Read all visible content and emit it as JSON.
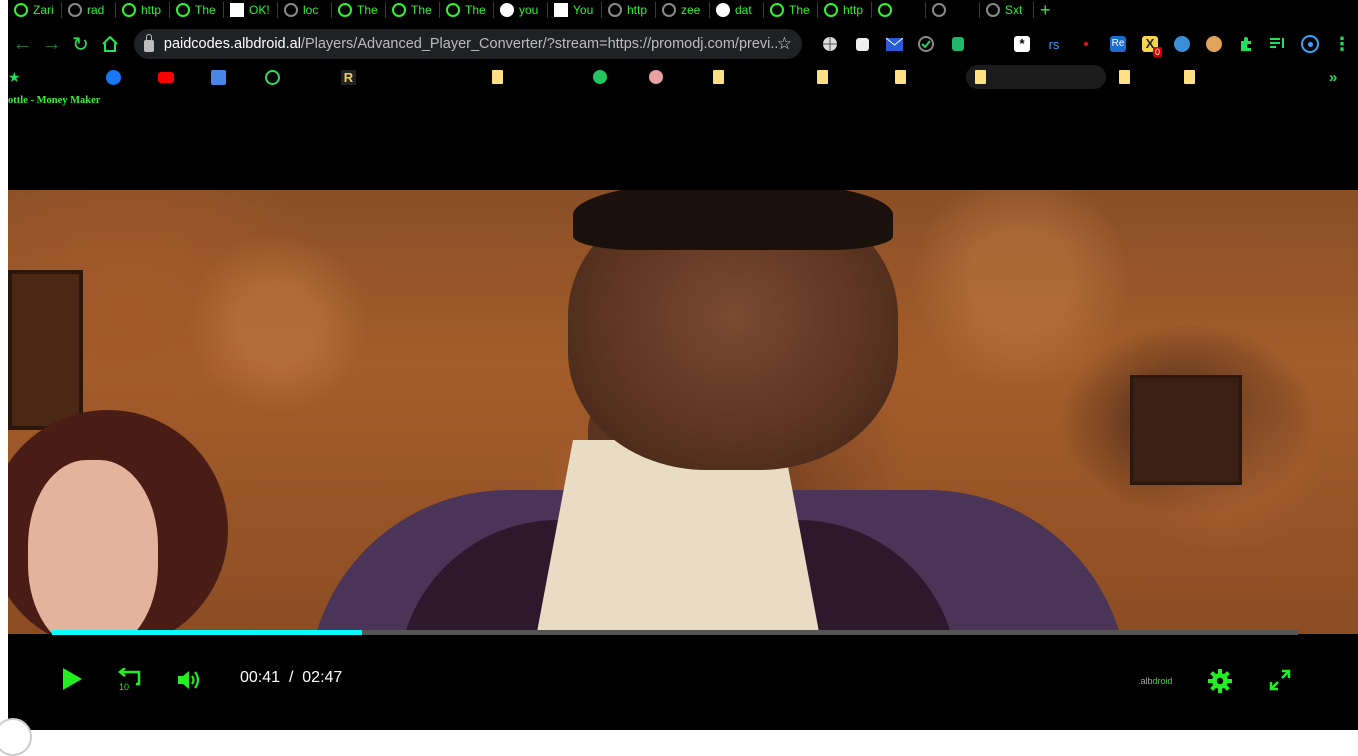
{
  "tabs": [
    {
      "label": "Zari",
      "icon": "player-icon"
    },
    {
      "label": "rad",
      "icon": "globe-gray-icon"
    },
    {
      "label": "http",
      "icon": "player-icon"
    },
    {
      "label": "The",
      "icon": "player-icon"
    },
    {
      "label": "OK!",
      "icon": "tosel-icon"
    },
    {
      "label": "loc",
      "icon": "globe-gray-icon"
    },
    {
      "label": "The",
      "icon": "player-icon"
    },
    {
      "label": "The",
      "icon": "player-icon"
    },
    {
      "label": "The",
      "icon": "player-icon"
    },
    {
      "label": "you",
      "icon": "google-icon"
    },
    {
      "label": "You",
      "icon": "blank-icon"
    },
    {
      "label": "http",
      "icon": "globe-gray-icon"
    },
    {
      "label": "zee",
      "icon": "loading-icon"
    },
    {
      "label": "dat",
      "icon": "google-icon"
    },
    {
      "label": "The",
      "icon": "player-icon"
    },
    {
      "label": "http",
      "icon": "player-icon"
    },
    {
      "label": "",
      "icon": "player-icon"
    },
    {
      "label": "",
      "icon": "mute-icon"
    },
    {
      "label": "Sxt",
      "icon": "loading-icon"
    }
  ],
  "toolbar": {
    "url_domain": "paidcodes.albdroid.al",
    "url_path": "/Players/Advanced_Player_Converter/?stream=https://promodj.com/previ...",
    "extensions_badge": "0"
  },
  "page": {
    "title": "ottle - Money Maker"
  },
  "player": {
    "current_time": "00:41",
    "separator": "/",
    "duration": "02:47",
    "progress_fraction": 0.249,
    "brand_prefix": ".alb",
    "brand_suffix": "droid",
    "accent_color": "#22ee22",
    "progress_color": "#00ffff"
  }
}
